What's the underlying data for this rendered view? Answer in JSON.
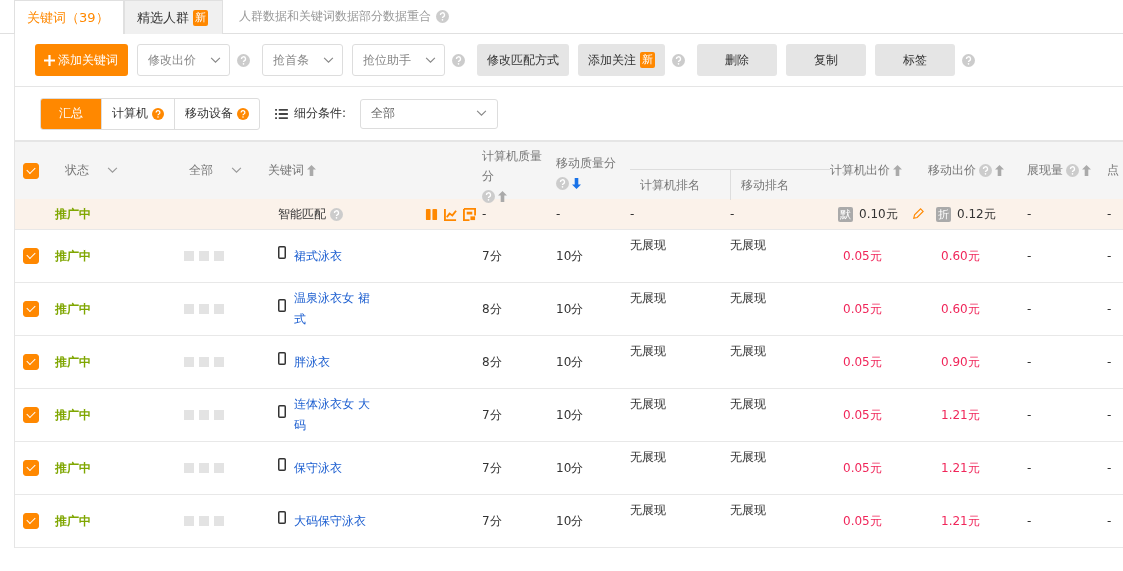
{
  "tabs": [
    {
      "label": "关键词（39）",
      "selected": true
    },
    {
      "label": "精选人群",
      "badge": "新",
      "selected": false
    }
  ],
  "tab_note": "人群数据和关键词数据部分数据重合",
  "toolbar": [
    {
      "kind": "primary",
      "label": "添加关键词"
    },
    {
      "kind": "dropdown",
      "label": "修改出价",
      "help": true
    },
    {
      "kind": "dropdown",
      "label": "抢首条"
    },
    {
      "kind": "dropdown",
      "label": "抢位助手",
      "help": true
    },
    {
      "kind": "button",
      "label": "修改匹配方式"
    },
    {
      "kind": "button",
      "label": "添加关注",
      "badge": "新",
      "help": true
    },
    {
      "kind": "button",
      "label": "删除"
    },
    {
      "kind": "button",
      "label": "复制"
    },
    {
      "kind": "button",
      "label": "标签",
      "help": true
    }
  ],
  "segments": [
    {
      "label": "汇总",
      "selected": true
    },
    {
      "label": "计算机",
      "help": true,
      "selected": false
    },
    {
      "label": "移动设备",
      "help": true,
      "selected": false
    }
  ],
  "filter": {
    "label": "细分条件:",
    "value": "全部"
  },
  "table": {
    "select_all": {
      "checked": true
    },
    "columns": [
      {
        "label": "状态",
        "dropdown": true
      },
      {
        "label": "全部",
        "dropdown": true
      },
      {
        "label": "关键词",
        "sorted": false
      },
      {
        "label": "计算机质量分",
        "help": true,
        "sorted": false
      },
      {
        "label": "移动质量分",
        "help": true,
        "sorted": true
      },
      {
        "kind": "group",
        "children": [
          {
            "label": "计算机排名"
          },
          {
            "label": "移动排名"
          }
        ]
      },
      {
        "label": "计算机出价",
        "sorted": false
      },
      {
        "label": "移动出价",
        "help": true,
        "sorted": false
      },
      {
        "label": "展现量",
        "help": true,
        "sorted": false
      },
      {
        "label": "点"
      }
    ],
    "smart_row": {
      "status": "推广中",
      "keyword": "智能匹配",
      "pc_quality": "-",
      "mobile_quality": "-",
      "pc_rank": "-",
      "mobile_rank": "-",
      "pc_bid": {
        "badge": "默",
        "value": "0.10元"
      },
      "mobile_bid": {
        "badge": "折",
        "value": "0.12元"
      },
      "impressions": "-",
      "clicks": "-"
    },
    "rows": [
      {
        "checked": true,
        "status": "推广中",
        "keyword": "裙式泳衣",
        "pc_quality": "7分",
        "mobile_quality": "10分",
        "pc_rank": "无展现",
        "mobile_rank": "无展现",
        "pc_bid": "0.05元",
        "mobile_bid": "0.60元",
        "impressions": "-",
        "clicks": "-"
      },
      {
        "checked": true,
        "status": "推广中",
        "keyword": "温泉泳衣女 裙式",
        "pc_quality": "8分",
        "mobile_quality": "10分",
        "pc_rank": "无展现",
        "mobile_rank": "无展现",
        "pc_bid": "0.05元",
        "mobile_bid": "0.60元",
        "impressions": "-",
        "clicks": "-"
      },
      {
        "checked": true,
        "status": "推广中",
        "keyword": "胖泳衣",
        "pc_quality": "8分",
        "mobile_quality": "10分",
        "pc_rank": "无展现",
        "mobile_rank": "无展现",
        "pc_bid": "0.05元",
        "mobile_bid": "0.90元",
        "impressions": "-",
        "clicks": "-"
      },
      {
        "checked": true,
        "status": "推广中",
        "keyword": "连体泳衣女 大码",
        "pc_quality": "7分",
        "mobile_quality": "10分",
        "pc_rank": "无展现",
        "mobile_rank": "无展现",
        "pc_bid": "0.05元",
        "mobile_bid": "1.21元",
        "impressions": "-",
        "clicks": "-"
      },
      {
        "checked": true,
        "status": "推广中",
        "keyword": "保守泳衣",
        "pc_quality": "7分",
        "mobile_quality": "10分",
        "pc_rank": "无展现",
        "mobile_rank": "无展现",
        "pc_bid": "0.05元",
        "mobile_bid": "1.21元",
        "impressions": "-",
        "clicks": "-"
      },
      {
        "checked": true,
        "status": "推广中",
        "keyword": "大码保守泳衣",
        "pc_quality": "7分",
        "mobile_quality": "10分",
        "pc_rank": "无展现",
        "mobile_rank": "无展现",
        "pc_bid": "0.05元",
        "mobile_bid": "1.21元",
        "impressions": "-",
        "clicks": "-"
      }
    ]
  }
}
